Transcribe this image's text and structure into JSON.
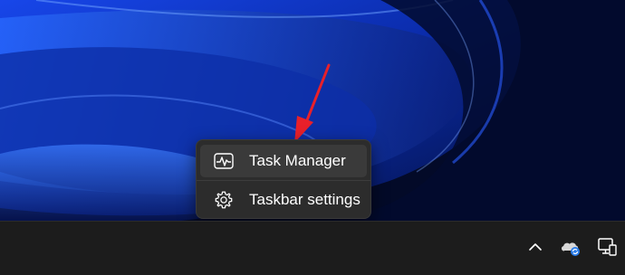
{
  "context_menu": {
    "items": [
      {
        "label": "Task Manager",
        "icon": "task-manager-icon"
      },
      {
        "label": "Taskbar settings",
        "icon": "gear-icon"
      }
    ]
  },
  "taskbar": {
    "tray_icons": [
      "chevron-up-icon",
      "onedrive-sync-icon",
      "network-icon"
    ]
  },
  "colors": {
    "menu_background": "#2c2c2c",
    "menu_hover": "#3a3a3a",
    "taskbar_background": "#1c1c1c",
    "annotation_arrow": "#e8202a",
    "wallpaper_accent": "#1e5bff"
  }
}
